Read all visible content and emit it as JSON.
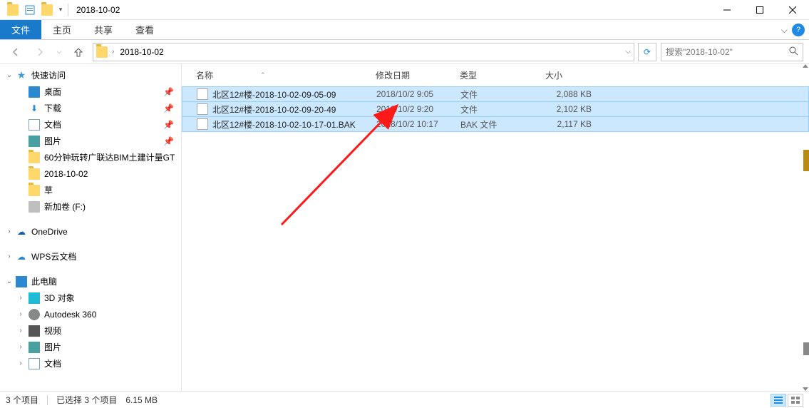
{
  "window": {
    "title": "2018-10-02",
    "qat_dropdown": "▾"
  },
  "ribbon": {
    "tabs": {
      "file": "文件",
      "home": "主页",
      "share": "共享",
      "view": "查看"
    },
    "help": "?"
  },
  "nav": {
    "crumb": "2018-10-02",
    "addr_chev": "›",
    "dropdown": "⌵",
    "refresh": "⟳",
    "search_placeholder": "搜索\"2018-10-02\""
  },
  "sidebar": {
    "quick_access": "快速访问",
    "items": [
      {
        "label": "桌面",
        "icon": "desktop",
        "pin": true
      },
      {
        "label": "下载",
        "icon": "download",
        "pin": true
      },
      {
        "label": "文档",
        "icon": "doc",
        "pin": true
      },
      {
        "label": "图片",
        "icon": "pic",
        "pin": true
      },
      {
        "label": "60分钟玩转广联达BIM土建计量GT",
        "icon": "folder",
        "pin": false
      },
      {
        "label": "2018-10-02",
        "icon": "folder",
        "pin": false
      },
      {
        "label": "草",
        "icon": "folder",
        "pin": false
      },
      {
        "label": "新加卷 (F:)",
        "icon": "drive",
        "pin": false
      }
    ],
    "onedrive": "OneDrive",
    "wps": "WPS云文档",
    "this_pc": "此电脑",
    "pc_items": [
      {
        "label": "3D 对象",
        "icon": "threed"
      },
      {
        "label": "Autodesk 360",
        "icon": "autodesk"
      },
      {
        "label": "视频",
        "icon": "video"
      },
      {
        "label": "图片",
        "icon": "pic"
      },
      {
        "label": "文档",
        "icon": "doc"
      }
    ]
  },
  "columns": {
    "name": "名称",
    "date": "修改日期",
    "type": "类型",
    "size": "大小",
    "sort": "⌃"
  },
  "files": [
    {
      "name": "北区12#楼-2018-10-02-09-05-09",
      "date": "2018/10/2 9:05",
      "type": "文件",
      "size": "2,088 KB"
    },
    {
      "name": "北区12#楼-2018-10-02-09-20-49",
      "date": "2018/10/2 9:20",
      "type": "文件",
      "size": "2,102 KB"
    },
    {
      "name": "北区12#楼-2018-10-02-10-17-01.BAK",
      "date": "2018/10/2 10:17",
      "type": "BAK 文件",
      "size": "2,117 KB"
    }
  ],
  "status": {
    "count": "3 个项目",
    "selected": "已选择 3 个项目",
    "size": "6.15 MB"
  }
}
